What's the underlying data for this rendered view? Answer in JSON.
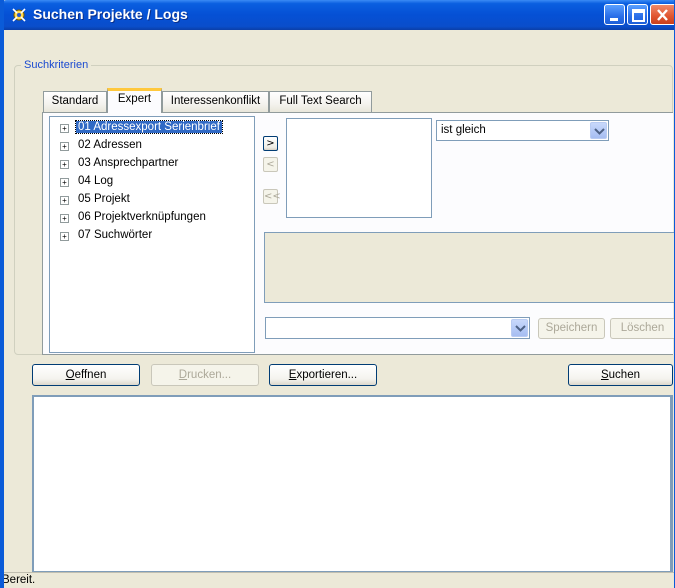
{
  "window": {
    "title": "Suchen Projekte / Logs"
  },
  "group": {
    "legend": "Suchkriterien"
  },
  "tabs": [
    {
      "label": "Standard",
      "active": false
    },
    {
      "label": "Expert",
      "active": true
    },
    {
      "label": "Interessenkonflikt",
      "active": false
    },
    {
      "label": "Full Text Search",
      "active": false
    }
  ],
  "tree": {
    "items": [
      {
        "label": "01 Adressexport Serienbrief",
        "selected": true
      },
      {
        "label": "02 Adressen"
      },
      {
        "label": "03 Ansprechpartner"
      },
      {
        "label": "04 Log"
      },
      {
        "label": "05 Projekt"
      },
      {
        "label": "06 Projektverknüpfungen"
      },
      {
        "label": "07 Suchwörter"
      }
    ],
    "expander_glyph": "+"
  },
  "move_buttons": {
    "add": ">",
    "remove": "<",
    "remove_all": "<<"
  },
  "operator_combo": {
    "value": "ist gleich"
  },
  "saved_search_combo": {
    "value": ""
  },
  "buttons": {
    "speichern": "Speichern",
    "loeschen": "Löschen",
    "oeffnen": {
      "mnemonic": "O",
      "rest": "effnen"
    },
    "drucken": {
      "mnemonic": "D",
      "rest": "rucken..."
    },
    "exportieren": {
      "mnemonic": "E",
      "rest": "xportieren..."
    },
    "suchen": {
      "mnemonic": "S",
      "rest": "uchen"
    }
  },
  "status": {
    "text": "Bereit."
  },
  "colors": {
    "titlebar": "#0550d5",
    "legend": "#1a4ad0",
    "selection": "#316ac5",
    "active_tab_accent": "#ffc83c"
  }
}
